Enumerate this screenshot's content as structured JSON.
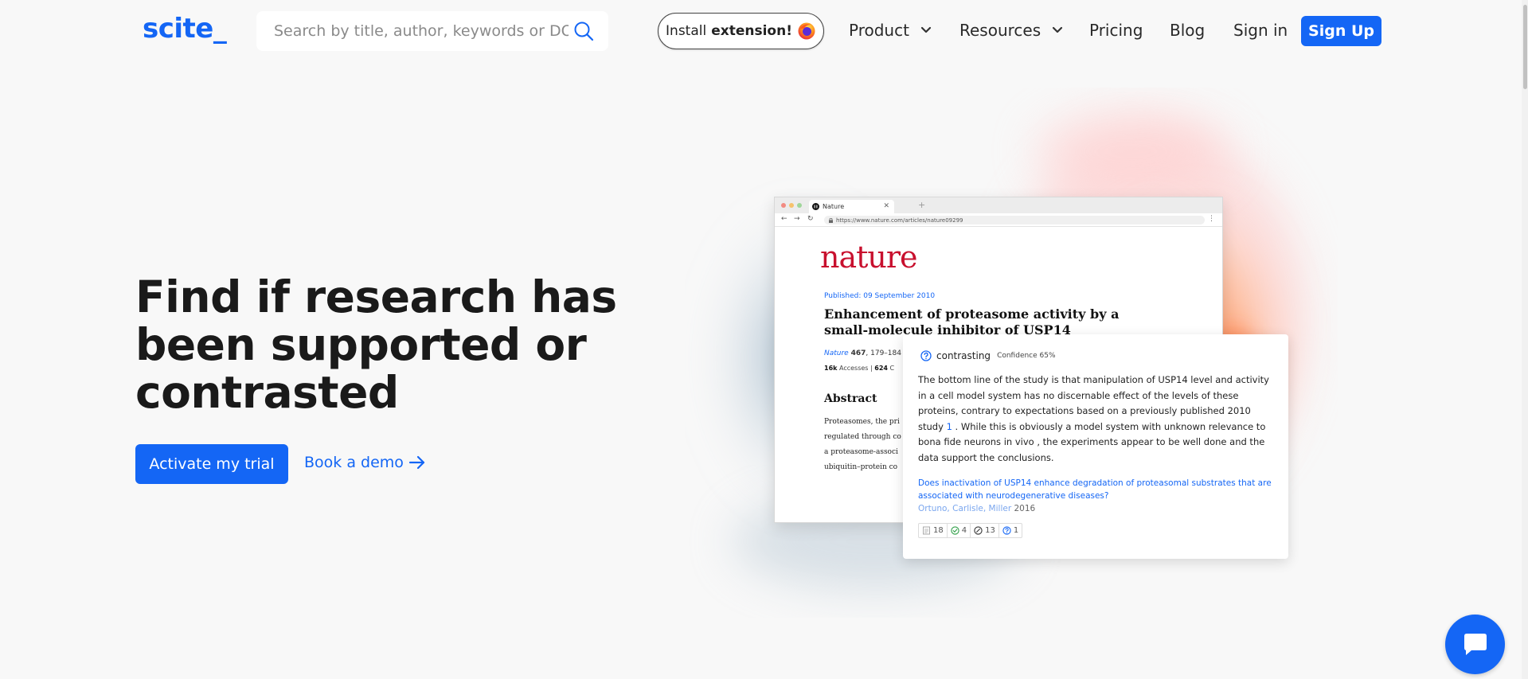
{
  "header": {
    "logo": "scite_",
    "search_placeholder": "Search by title, author, keywords or DOI",
    "install": {
      "prefix": "Install",
      "bold": "extension!"
    },
    "nav": [
      {
        "label": "Product",
        "has_dropdown": true
      },
      {
        "label": "Resources",
        "has_dropdown": true
      },
      {
        "label": "Pricing"
      },
      {
        "label": "Blog"
      },
      {
        "label": "Sign in"
      }
    ],
    "signup": "Sign Up"
  },
  "hero": {
    "title": "Find if research has been supported or contrasted",
    "trial_button": "Activate my trial",
    "demo_link": "Book a demo"
  },
  "browser": {
    "tab_title": "Nature",
    "url": "https://www.nature.com/articles/nature09299",
    "brand": "nature",
    "published": "Published: 09 September 2010",
    "title": "Enhancement of proteasome activity by a small-molecule inhibitor of USP14",
    "journal": "Nature",
    "volume": "467",
    "pages": ", 179–184 (2",
    "accesses_count": "16k",
    "accesses_label": "Accesses",
    "citations_count": "624",
    "citations_label": "C",
    "abstract_heading": "Abstract",
    "abstract_lines": [
      "Proteasomes, the pri",
      "regulated through co",
      "a proteasome-associ",
      "ubiquitin–protein co"
    ]
  },
  "citation_card": {
    "type": "contrasting",
    "confidence": "Confidence 65%",
    "snippet_before": "The bottom line of the study is that manipulation of USP14 level and activity in a cell model system has no discernable effect of the levels of these proteins, contrary to expectations based on a previously published 2010 study",
    "ref_number": "1",
    "snippet_after": ". While this is obviously a model system with unknown relevance to bona fide neurons in vivo , the experiments appear to be well done and the data support the conclusions.",
    "linked_title": "Does inactivation of USP14 enhance degradation of proteasomal substrates that are associated with neurodegenerative diseases?",
    "authors": "Ortuno, Carlisle, Miller",
    "year": "2016",
    "stats": {
      "mentioning": "18",
      "supporting": "4",
      "contrasting": "13",
      "unclassified": "1"
    }
  },
  "colors": {
    "brand_blue": "#1466f5",
    "nature_red": "#c8102e",
    "background": "#f8f8f8"
  },
  "icons": [
    "search-icon",
    "firefox-icon",
    "chevron-down-icon",
    "arrow-right-icon",
    "question-circle-icon",
    "check-circle-icon",
    "slash-circle-icon",
    "document-icon",
    "chat-icon"
  ]
}
